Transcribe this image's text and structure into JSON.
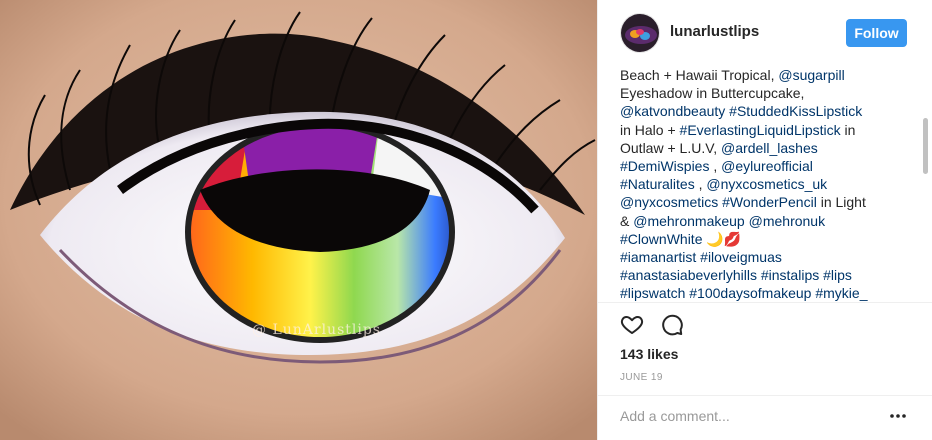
{
  "post": {
    "username": "lunarlustlips",
    "follow_label": "Follow",
    "watermark": "@ LunArlustlips",
    "caption_lines": [
      [
        {
          "t": "Beach + Hawaii Tropical, "
        },
        {
          "t": "@sugarpill",
          "h": true
        }
      ],
      [
        {
          "t": "Eyeshadow in Buttercupcake,"
        }
      ],
      [
        {
          "t": "@katvondbeauty",
          "h": true
        },
        {
          "t": " "
        },
        {
          "t": "#StuddedKissLipstick",
          "h": true
        }
      ],
      [
        {
          "t": "in Halo + "
        },
        {
          "t": "#EverlastingLiquidLipstick",
          "h": true
        },
        {
          "t": " in"
        }
      ],
      [
        {
          "t": "Outlaw + L.U.V, "
        },
        {
          "t": "@ardell_lashes",
          "h": true
        }
      ],
      [
        {
          "t": "#DemiWispies",
          "h": true
        },
        {
          "t": " , "
        },
        {
          "t": "@eylureofficial",
          "h": true
        }
      ],
      [
        {
          "t": "#Naturalites",
          "h": true
        },
        {
          "t": " , "
        },
        {
          "t": "@nyxcosmetics_uk",
          "h": true
        }
      ],
      [
        {
          "t": "@nyxcosmetics",
          "h": true
        },
        {
          "t": " "
        },
        {
          "t": "#WonderPencil",
          "h": true
        },
        {
          "t": " in Light"
        }
      ],
      [
        {
          "t": "& "
        },
        {
          "t": "@mehronmakeup",
          "h": true
        },
        {
          "t": " "
        },
        {
          "t": "@mehronuk",
          "h": true
        }
      ],
      [
        {
          "t": "#ClownWhite",
          "h": true
        },
        {
          "t": " 🌙💋"
        }
      ],
      [
        {
          "t": "#iamanartist",
          "h": true
        },
        {
          "t": " "
        },
        {
          "t": "#iloveigmuas",
          "h": true
        }
      ],
      [
        {
          "t": "#anastasiabeverlyhills",
          "h": true
        },
        {
          "t": " "
        },
        {
          "t": "#instalips",
          "h": true
        },
        {
          "t": " "
        },
        {
          "t": "#lips",
          "h": true
        }
      ],
      [
        {
          "t": "#lipswatch",
          "h": true
        },
        {
          "t": " "
        },
        {
          "t": "#100daysofmakeup",
          "h": true
        },
        {
          "t": " "
        },
        {
          "t": "#mykie_",
          "h": true
        }
      ]
    ],
    "likes": "143 likes",
    "date": "JUNE 19",
    "comment_placeholder": "Add a comment...",
    "icons": {
      "like": "heart-icon",
      "comment": "comment-icon",
      "more": "more-options-icon"
    },
    "colors": {
      "accent": "#3897f0",
      "link": "#003569",
      "muted": "#999999"
    }
  }
}
